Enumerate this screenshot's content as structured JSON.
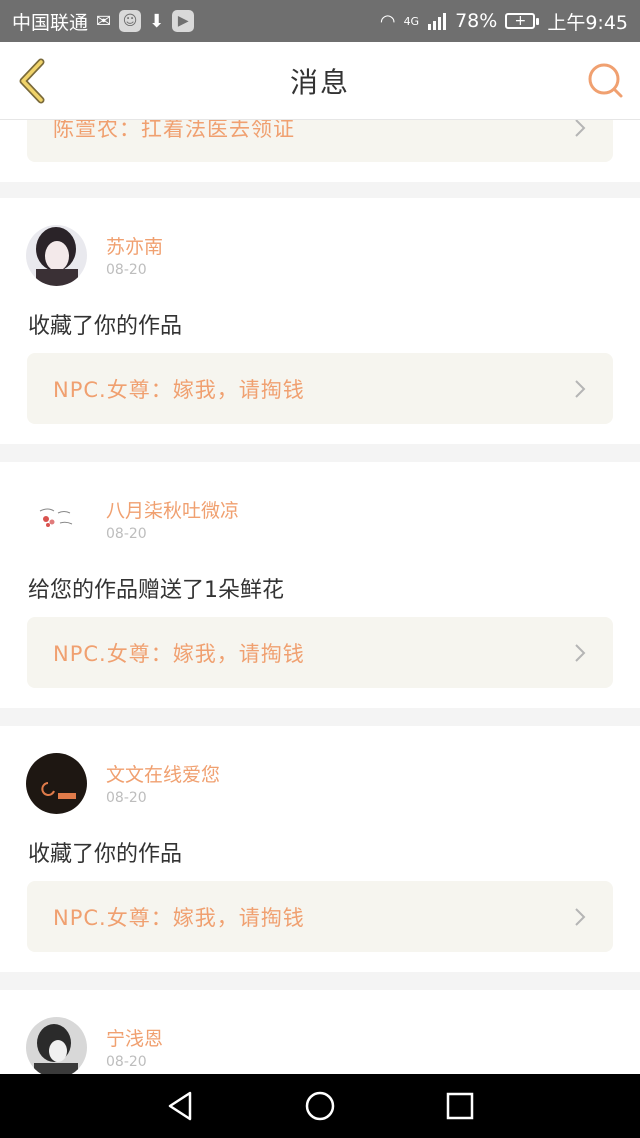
{
  "status_bar": {
    "carrier": "中国联通",
    "network": "4G",
    "battery_percent": "78%",
    "time": "上午9:45"
  },
  "header": {
    "title": "消息"
  },
  "colors": {
    "accent": "#f0a070",
    "status_bar_bg": "#6f6f6f",
    "work_box_bg": "#f6f5ef",
    "nav_bar_bg": "#000000"
  },
  "top_partial": {
    "work_title": "陈萱农：扛着法医去领证"
  },
  "notifications": [
    {
      "username": "苏亦南",
      "date": "08-20",
      "message": "收藏了你的作品",
      "work_title": "NPC.女尊：嫁我，请掏钱"
    },
    {
      "username": "八月柒秋吐微凉",
      "date": "08-20",
      "message": "给您的作品赠送了1朵鲜花",
      "work_title": "NPC.女尊：嫁我，请掏钱"
    },
    {
      "username": "文文在线爱您",
      "date": "08-20",
      "message": "收藏了你的作品",
      "work_title": "NPC.女尊：嫁我，请掏钱"
    },
    {
      "username": "宁浅恩",
      "date": "08-20"
    }
  ],
  "icons": {
    "back": "chevron-left-icon",
    "search": "search-icon",
    "nav_back": "triangle-back-icon",
    "nav_home": "circle-home-icon",
    "nav_recent": "square-recent-icon"
  }
}
